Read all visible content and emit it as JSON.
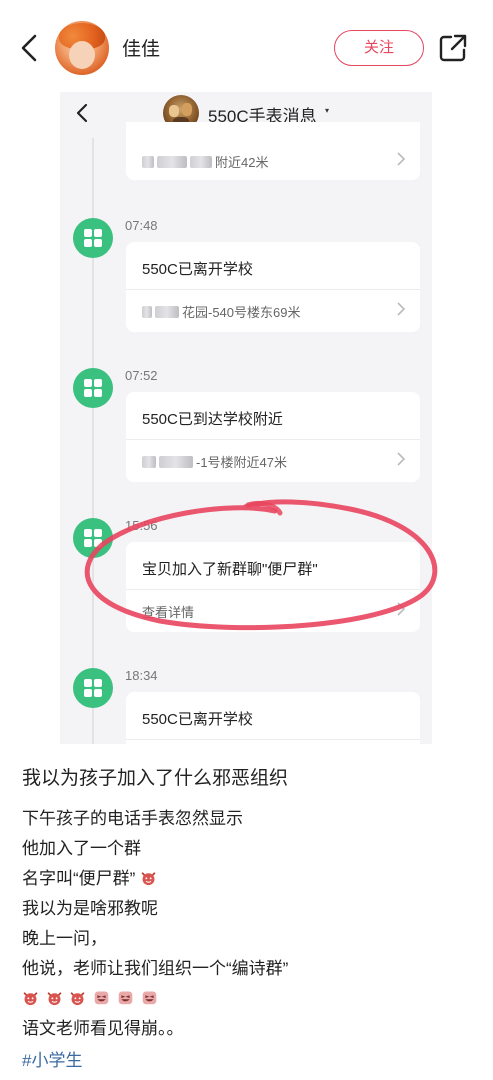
{
  "header": {
    "username": "佳佳",
    "follow_label": "关注"
  },
  "screenshot": {
    "title": "550C手表消息",
    "caret": "▾",
    "events": [
      {
        "time": "",
        "title": "",
        "location": "附近42米"
      },
      {
        "time": "07:48",
        "title": "550C已离开学校",
        "location": "花园-540号楼东69米"
      },
      {
        "time": "07:52",
        "title": "550C已到达学校附近",
        "location": "-1号楼附近47米"
      },
      {
        "time": "15:56",
        "title": "宝贝加入了新群聊\"便尸群\"",
        "location": "查看详情"
      },
      {
        "time": "18:34",
        "title": "550C已离开学校",
        "location": ""
      }
    ],
    "accent_green": "#3ac07f",
    "highlight_red": "#e8455e"
  },
  "post": {
    "title": "我以为孩子加入了什么邪恶组织",
    "lines": [
      "下午孩子的电话手表忽然显示",
      "他加入了一个群",
      "名字叫“便尸群”",
      "我以为是啥邪教呢",
      "晚上一问，",
      "他说，老师让我们组织一个“编诗群”",
      "",
      "语文老师看见得崩。。"
    ],
    "hashtag": "#小学生",
    "emoji_names": [
      "devil-emoji",
      "devil-emoji",
      "devil-emoji",
      "devil-emoji",
      "laughing-emoji",
      "laughing-emoji",
      "laughing-emoji"
    ]
  }
}
